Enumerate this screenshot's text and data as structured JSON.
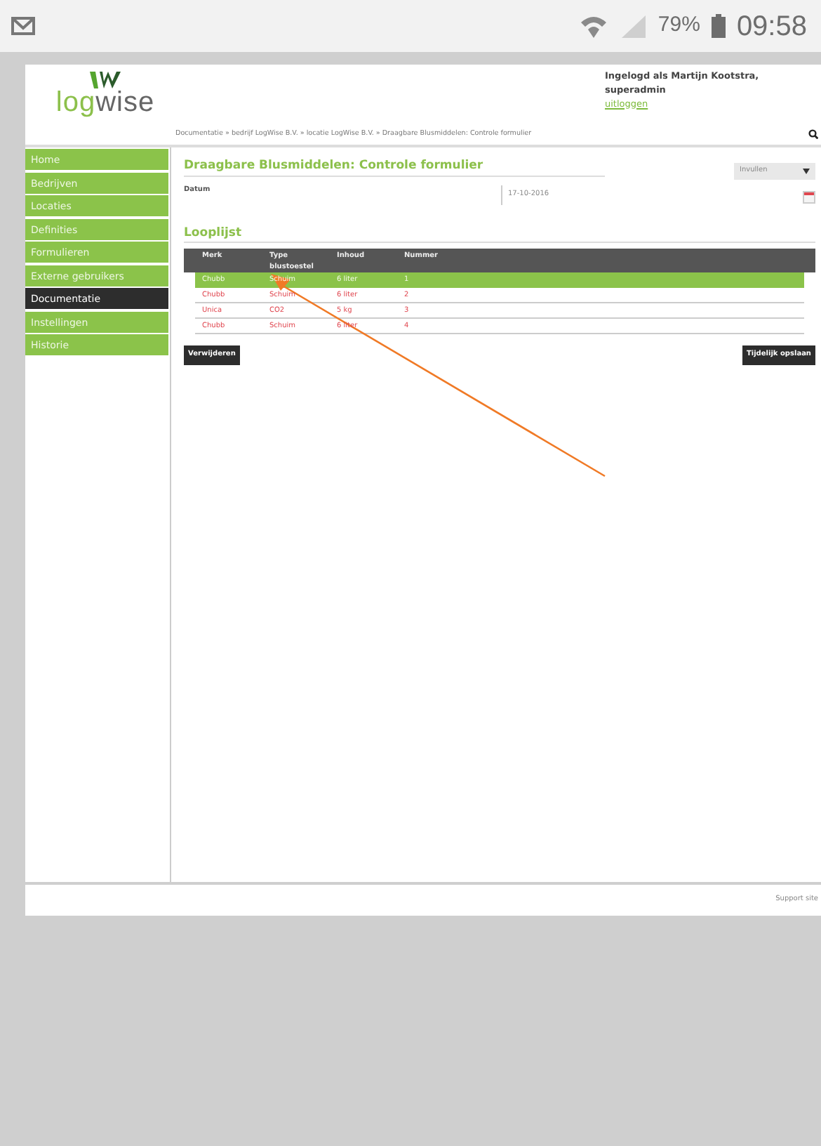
{
  "status_bar": {
    "battery": "79%",
    "time": "09:58"
  },
  "logo": {
    "first": "log",
    "second": "wise"
  },
  "header": {
    "user": "Ingelogd als Martijn Kootstra, superadmin",
    "logout": "uitloggen",
    "breadcrumb": "Documentatie » bedrijf LogWise B.V. » locatie LogWise B.V. » Draagbare Blusmiddelen: Controle formulier"
  },
  "sidebar": {
    "items": [
      {
        "label": "Home",
        "selected": false
      },
      {
        "label": "Bedrijven",
        "selected": false
      },
      {
        "label": "Locaties",
        "selected": false
      },
      {
        "label": "Definities",
        "selected": false
      },
      {
        "label": "Formulieren",
        "selected": false
      },
      {
        "label": "Externe gebruikers",
        "selected": false
      },
      {
        "label": "Documentatie",
        "selected": true
      },
      {
        "label": "Instellingen",
        "selected": false
      },
      {
        "label": "Historie",
        "selected": false
      }
    ]
  },
  "form": {
    "title": "Draagbare Blusmiddelen: Controle formulier",
    "mode": "Invullen",
    "date_label": "Datum",
    "date_value": "17-10-2016"
  },
  "looplijst": {
    "title": "Looplijst",
    "columns": [
      "Merk",
      "Type blustoestel",
      "Inhoud",
      "Nummer"
    ],
    "rows": [
      {
        "cells": [
          "Chubb",
          "Schuim",
          "6 liter",
          "1"
        ],
        "selected": true
      },
      {
        "cells": [
          "Chubb",
          "Schuim",
          "6 liter",
          "2"
        ],
        "selected": false
      },
      {
        "cells": [
          "Unica",
          "CO2",
          "5 kg",
          "3"
        ],
        "selected": false
      },
      {
        "cells": [
          "Chubb",
          "Schuim",
          "6 liter",
          "4"
        ],
        "selected": false
      }
    ],
    "buttons": [
      "Verwijderen",
      "Tijdelijk opslaan"
    ]
  },
  "footer": {
    "link": "Support site"
  }
}
